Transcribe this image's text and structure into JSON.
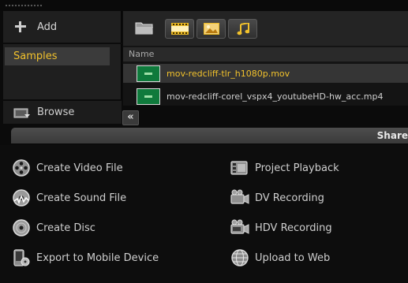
{
  "library": {
    "add_label": "Add",
    "items": [
      {
        "label": "Samples",
        "selected": true
      }
    ],
    "browse_label": "Browse"
  },
  "file_list": {
    "column_name": "Name",
    "files": [
      {
        "name": "mov-redcliff-tlr_h1080p.mov",
        "selected": true
      },
      {
        "name": "mov-redcliff-corel_vspx4_youtubeHD-hw_acc.mp4",
        "selected": false
      }
    ]
  },
  "toolbar": {
    "icons": [
      "folder-icon",
      "film-icon",
      "image-icon",
      "music-icon"
    ]
  },
  "share": {
    "title": "Share",
    "options": [
      {
        "label": "Create Video File",
        "icon": "film-reel-icon"
      },
      {
        "label": "Create Sound File",
        "icon": "sound-disc-icon"
      },
      {
        "label": "Create Disc",
        "icon": "disc-icon"
      },
      {
        "label": "Export to Mobile Device",
        "icon": "mobile-device-icon"
      },
      {
        "label": "Project Playback",
        "icon": "projector-icon"
      },
      {
        "label": "DV Recording",
        "icon": "camcorder-icon"
      },
      {
        "label": "HDV Recording",
        "icon": "hdv-camcorder-icon"
      },
      {
        "label": "Upload to Web",
        "icon": "globe-icon"
      }
    ]
  },
  "colors": {
    "accent": "#f2c22c",
    "background": "#0b0b0b",
    "panel": "#1f1f1f"
  }
}
